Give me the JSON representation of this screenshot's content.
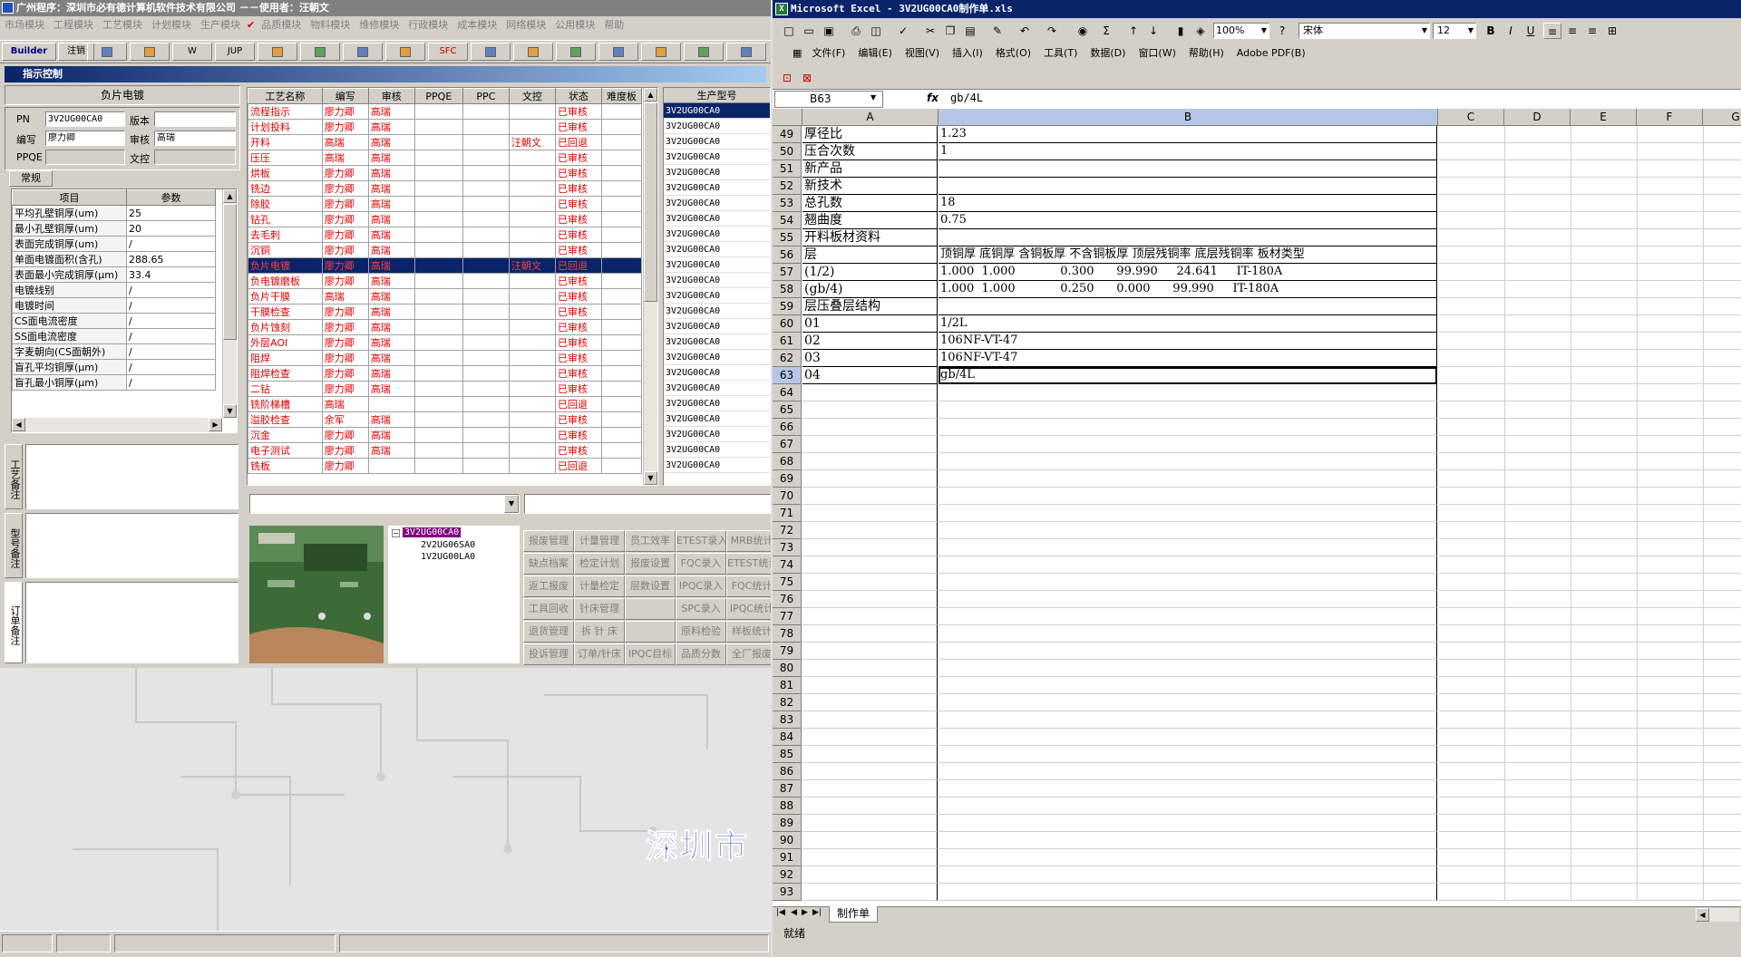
{
  "left_app": {
    "title": "广州程序：深圳市必有德计算机软件技术有限公司 －－使用者：汪朝文",
    "menu": [
      "市场模块",
      "工程模块",
      "工艺模块",
      "计划模块",
      "生产模块",
      "品质模块",
      "物料模块",
      "维修模块",
      "行政模块",
      "成本模块",
      "网络模块",
      "公用模块",
      "帮助"
    ],
    "toolbar": [
      "Builder",
      "注销",
      "",
      "",
      "W",
      "JUP",
      "",
      "",
      "",
      "",
      "SFC",
      "",
      "",
      "",
      "",
      "",
      "",
      ""
    ],
    "panel_title": "指示控制",
    "process_title": "负片电镀",
    "fields": {
      "pn_label": "PN",
      "pn": "3V2UG00CA0",
      "ver_label": "版本",
      "ver": "",
      "editor_label": "编写",
      "editor": "廖力卿",
      "reviewer_label": "审核",
      "reviewer": "高瑞",
      "ppqe_label": "PPQE",
      "ppqe": "",
      "doc_label": "文控",
      "doc": ""
    },
    "tab_general": "常规",
    "param_headers": [
      "项目",
      "参数"
    ],
    "params": [
      [
        "平均孔壁铜厚(um)",
        "25"
      ],
      [
        "最小孔壁铜厚(um)",
        "20"
      ],
      [
        "表面完成铜厚(um)",
        "/"
      ],
      [
        "单面电镀面积(含孔)",
        "288.65"
      ],
      [
        "表面最小完成铜厚(μm)",
        "33.4"
      ],
      [
        "电镀线别",
        "/"
      ],
      [
        "电镀时间",
        "/"
      ],
      [
        "CS面电流密度",
        "/"
      ],
      [
        "SS面电流密度",
        "/"
      ],
      [
        "字麦朝向(CS面朝外)",
        "/"
      ],
      [
        "盲孔平均铜厚(μm)",
        "/"
      ],
      [
        "盲孔最小铜厚(μm)",
        "/"
      ]
    ],
    "side_tabs": [
      "工艺备注",
      "型号备注",
      "订单备注"
    ],
    "proc_headers": [
      "工艺名称",
      "编写",
      "审核",
      "PPQE",
      "PPC",
      "文控",
      "状态",
      "难度板"
    ],
    "processes": [
      [
        "流程指示",
        "廖力卿",
        "高瑞",
        "",
        "",
        "",
        "已审核"
      ],
      [
        "计划投料",
        "廖力卿",
        "高瑞",
        "",
        "",
        "",
        "已审核"
      ],
      [
        "开料",
        "高瑞",
        "高瑞",
        "",
        "",
        "汪朝文",
        "已回退"
      ],
      [
        "压压",
        "高瑞",
        "高瑞",
        "",
        "",
        "",
        "已审核"
      ],
      [
        "烘板",
        "廖力卿",
        "高瑞",
        "",
        "",
        "",
        "已审核"
      ],
      [
        "铣边",
        "廖力卿",
        "高瑞",
        "",
        "",
        "",
        "已审核"
      ],
      [
        "除胶",
        "廖力卿",
        "高瑞",
        "",
        "",
        "",
        "已审核"
      ],
      [
        "钻孔",
        "廖力卿",
        "高瑞",
        "",
        "",
        "",
        "已审核"
      ],
      [
        "去毛刺",
        "廖力卿",
        "高瑞",
        "",
        "",
        "",
        "已审核"
      ],
      [
        "沉铜",
        "廖力卿",
        "高瑞",
        "",
        "",
        "",
        "已审核"
      ],
      [
        "负片电镀",
        "廖力卿",
        "高瑞",
        "",
        "",
        "汪朝文",
        "已回退"
      ],
      [
        "负电镀磨板",
        "廖力卿",
        "高瑞",
        "",
        "",
        "",
        "已审核"
      ],
      [
        "负片干膜",
        "高瑞",
        "高瑞",
        "",
        "",
        "",
        "已审核"
      ],
      [
        "干膜检查",
        "廖力卿",
        "高瑞",
        "",
        "",
        "",
        "已审核"
      ],
      [
        "负片蚀刻",
        "廖力卿",
        "高瑞",
        "",
        "",
        "",
        "已审核"
      ],
      [
        "外层AOI",
        "廖力卿",
        "高瑞",
        "",
        "",
        "",
        "已审核"
      ],
      [
        "阻焊",
        "廖力卿",
        "高瑞",
        "",
        "",
        "",
        "已审核"
      ],
      [
        "阻焊检查",
        "廖力卿",
        "高瑞",
        "",
        "",
        "",
        "已审核"
      ],
      [
        "二钻",
        "廖力卿",
        "高瑞",
        "",
        "",
        "",
        "已审核"
      ],
      [
        "铣阶梯槽",
        "高瑞",
        "",
        "",
        "",
        "",
        "已回退"
      ],
      [
        "溢胶检查",
        "余军",
        "高瑞",
        "",
        "",
        "",
        "已审核"
      ],
      [
        "沉金",
        "廖力卿",
        "高瑞",
        "",
        "",
        "",
        "已审核"
      ],
      [
        "电子测试",
        "廖力卿",
        "高瑞",
        "",
        "",
        "",
        "已审核"
      ],
      [
        "铣板",
        "廖力卿",
        "",
        "",
        "",
        "",
        "已回退"
      ]
    ],
    "model_header": "生产型号",
    "models": [
      "3V2UG00CA0",
      "3V2UG00CA0",
      "3V2UG00CA0",
      "3V2UG00CA0",
      "3V2UG00CA0",
      "3V2UG00CA0",
      "3V2UG00CA0",
      "3V2UG00CA0",
      "3V2UG00CA0",
      "3V2UG00CA0",
      "3V2UG00CA0",
      "3V2UG00CA0",
      "3V2UG00CA0",
      "3V2UG00CA0",
      "3V2UG00CA0",
      "3V2UG00CA0",
      "3V2UG00CA0",
      "3V2UG00CA0",
      "3V2UG00CA0",
      "3V2UG00CA0",
      "3V2UG00CA0",
      "3V2UG00CA0",
      "3V2UG00CA0",
      "3V2UG00CA0"
    ],
    "tree": [
      "3V2UG00CA0",
      "2V2UG06SA0",
      "1V2UG00LA0"
    ],
    "buttons": [
      [
        "报废管理",
        "计量管理",
        "员工效率",
        "ETEST录入",
        "MRB统计"
      ],
      [
        "缺点档案",
        "检定计划",
        "报废设置",
        "FQC录入",
        "ETEST统计"
      ],
      [
        "返工报废",
        "计量检定",
        "层数设置",
        "IPQC录入",
        "FQC统计"
      ],
      [
        "工具回收",
        "针床管理",
        "",
        "SPC录入",
        "IPQC统计"
      ],
      [
        "退货管理",
        "拆 针 床",
        "",
        "原料检验",
        "样板统计"
      ],
      [
        "投诉管理",
        "订单/针床",
        "IPQC目标",
        "品质分数",
        "全厂报废"
      ]
    ],
    "watermark": "深圳市"
  },
  "excel": {
    "title": "Microsoft Excel - 3V2UG00CA0制作单.xls",
    "menu": [
      "文件(F)",
      "编辑(E)",
      "视图(V)",
      "插入(I)",
      "格式(O)",
      "工具(T)",
      "数据(D)",
      "窗口(W)",
      "帮助(H)",
      "Adobe PDF(B)"
    ],
    "zoom": "100%",
    "font": "宋体",
    "font_size": "12",
    "name_box": "B63",
    "formula": "gb/4L",
    "columns": [
      "A",
      "B",
      "C",
      "D",
      "E",
      "F",
      "G"
    ],
    "rows": [
      {
        "n": "49",
        "a": "厚径比",
        "b": "1.23"
      },
      {
        "n": "50",
        "a": "压合次数",
        "b": "1"
      },
      {
        "n": "51",
        "a": "新产品",
        "b": ""
      },
      {
        "n": "52",
        "a": "新技术",
        "b": ""
      },
      {
        "n": "53",
        "a": "总孔数",
        "b": "18"
      },
      {
        "n": "54",
        "a": "翘曲度",
        "b": "0.75"
      },
      {
        "n": "55",
        "a": "开料板材资料",
        "b": ""
      },
      {
        "n": "56",
        "a": "层",
        "b": "顶铜厚 底铜厚 含铜板厚 不含铜板厚 顶层残铜率 底层残铜率 板材类型"
      },
      {
        "n": "57",
        "a": "(1/2)",
        "b": "1.000  1.000            0.300      99.990     24.641     IT-180A"
      },
      {
        "n": "58",
        "a": "(gb/4)",
        "b": "1.000  1.000            0.250      0.000      99.990     IT-180A"
      },
      {
        "n": "59",
        "a": "层压叠层结构",
        "b": ""
      },
      {
        "n": "60",
        "a": "01",
        "b": "1/2L"
      },
      {
        "n": "61",
        "a": "02",
        "b": "106NF-VT-47"
      },
      {
        "n": "62",
        "a": "03",
        "b": "106NF-VT-47"
      },
      {
        "n": "63",
        "a": "04",
        "b": "gb/4L"
      },
      {
        "n": "64",
        "a": "",
        "b": ""
      },
      {
        "n": "65",
        "a": "",
        "b": ""
      },
      {
        "n": "66",
        "a": "",
        "b": ""
      },
      {
        "n": "67",
        "a": "",
        "b": ""
      },
      {
        "n": "68",
        "a": "",
        "b": ""
      },
      {
        "n": "69",
        "a": "",
        "b": ""
      },
      {
        "n": "70",
        "a": "",
        "b": ""
      },
      {
        "n": "71",
        "a": "",
        "b": ""
      },
      {
        "n": "72",
        "a": "",
        "b": ""
      },
      {
        "n": "73",
        "a": "",
        "b": ""
      },
      {
        "n": "74",
        "a": "",
        "b": ""
      },
      {
        "n": "75",
        "a": "",
        "b": ""
      },
      {
        "n": "76",
        "a": "",
        "b": ""
      },
      {
        "n": "77",
        "a": "",
        "b": ""
      },
      {
        "n": "78",
        "a": "",
        "b": ""
      },
      {
        "n": "79",
        "a": "",
        "b": ""
      },
      {
        "n": "80",
        "a": "",
        "b": ""
      },
      {
        "n": "81",
        "a": "",
        "b": ""
      },
      {
        "n": "82",
        "a": "",
        "b": ""
      },
      {
        "n": "83",
        "a": "",
        "b": ""
      },
      {
        "n": "84",
        "a": "",
        "b": ""
      },
      {
        "n": "85",
        "a": "",
        "b": ""
      },
      {
        "n": "86",
        "a": "",
        "b": ""
      },
      {
        "n": "87",
        "a": "",
        "b": ""
      },
      {
        "n": "88",
        "a": "",
        "b": ""
      },
      {
        "n": "89",
        "a": "",
        "b": ""
      },
      {
        "n": "90",
        "a": "",
        "b": ""
      },
      {
        "n": "91",
        "a": "",
        "b": ""
      },
      {
        "n": "92",
        "a": "",
        "b": ""
      },
      {
        "n": "93",
        "a": "",
        "b": ""
      }
    ],
    "sheet_tab": "制作单",
    "status": "就绪"
  }
}
